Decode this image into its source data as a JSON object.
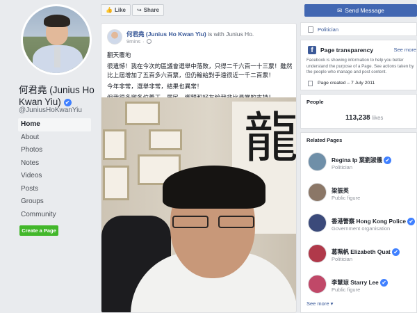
{
  "profile": {
    "name": "何君堯 (Junius Ho Kwan Yiu)",
    "handle": "@JuniusHoKwanYiu",
    "verified_icon": "✔"
  },
  "nav": [
    "Home",
    "About",
    "Photos",
    "Notes",
    "Videos",
    "Posts",
    "Groups",
    "Community"
  ],
  "create_page": "Create a Page",
  "actions": {
    "like": "Like",
    "share": "Share",
    "send_message": "Send Message"
  },
  "post": {
    "author": "何君堯 (Junius Ho Kwan Yiu)",
    "with_text": "is with Junius Ho.",
    "time": "9mins",
    "lines": [
      "翻天覆地",
      "很遺憾！我在今次的區議會選舉中落敗，只得二千六百一十三票！雖然比上屆增加了五百多六百票，但仍輸給對手遠很近一千二百票！",
      "今年非常，選舉非常，結果也異常！",
      "但我很多謝各位義工、居民、鄉親和好友給我非比尋常的支持！"
    ],
    "photo_calligraphy": "龍"
  },
  "sidebar": {
    "category": "Politician",
    "transparency_title": "Page transparency",
    "see_more": "See more",
    "transparency_text": "Facebook is showing information to help you better understand the purpose of a Page. See actions taken by the people who manage and post content.",
    "page_created": "Page created – 7 July 2011",
    "people_title": "People",
    "likes_count": "113,238",
    "likes_label": "likes",
    "related_title": "Related Pages",
    "related": [
      {
        "name": "Regina Ip 葉劉淑儀",
        "sub": "Politician",
        "color": "#6f8fa8"
      },
      {
        "name": "梁振英",
        "sub": "Public figure",
        "color": "#8b7767"
      },
      {
        "name": "香港警察 Hong Kong Police",
        "sub": "Government organisation",
        "color": "#3b4a7a"
      },
      {
        "name": "葛珮帆 Elizabeth Quat",
        "sub": "Politician",
        "color": "#b0394a"
      },
      {
        "name": "李慧琼 Starry Lee",
        "sub": "Public figure",
        "color": "#c04868"
      }
    ],
    "see_more_related": "See more"
  },
  "colors": {
    "brand_blue": "#4267b2",
    "green": "#42b72a",
    "link": "#385898"
  }
}
